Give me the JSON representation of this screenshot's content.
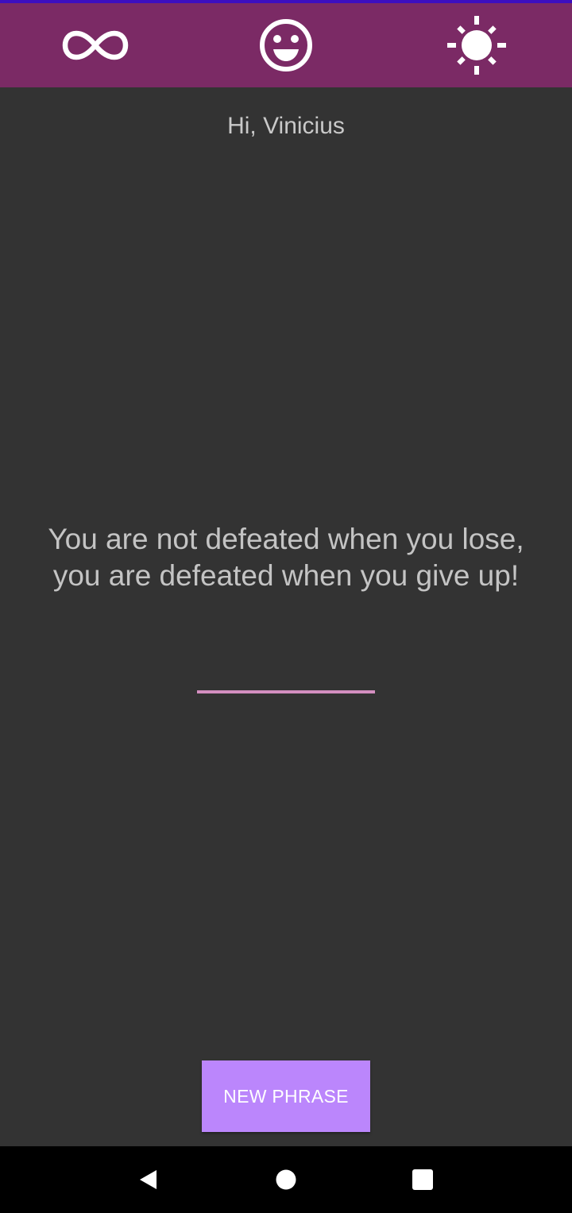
{
  "colors": {
    "background": "#333333",
    "toolbar": "#7b2a65",
    "status_accent": "#3d0fbf",
    "button": "#bb86fc",
    "divider": "#d48fc0",
    "text": "#c4c4c4",
    "navbar": "#000000"
  },
  "toolbar": {
    "icons": [
      "infinity-icon",
      "smiley-face-icon",
      "sun-icon"
    ]
  },
  "greeting": "Hi, Vinicius",
  "phrase": "You are not defeated when you lose, you are defeated when you give up!",
  "button": {
    "label": "NEW PHRASE"
  },
  "navbar": {
    "icons": [
      "back-triangle-icon",
      "home-circle-icon",
      "recents-square-icon"
    ]
  }
}
